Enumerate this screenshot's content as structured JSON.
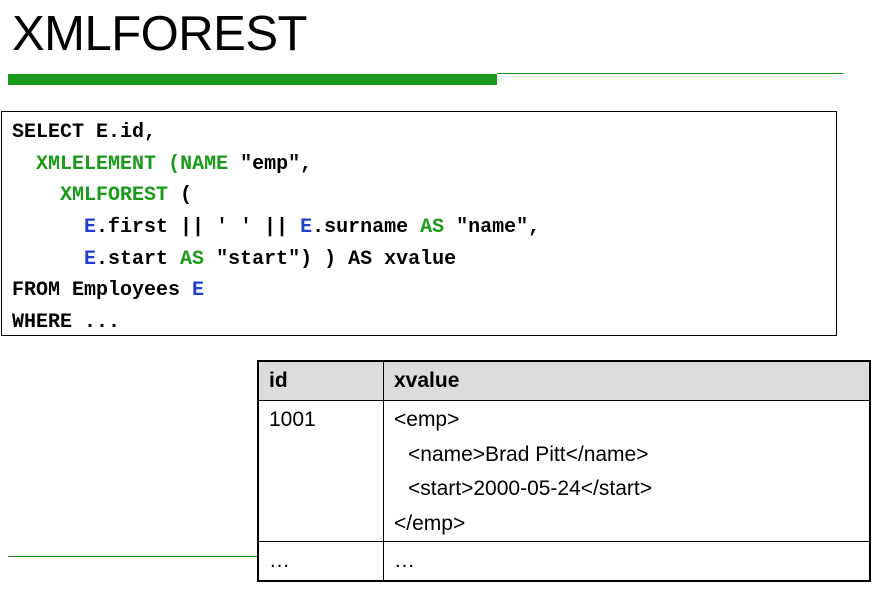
{
  "title": "XMLFOREST",
  "code": {
    "line1": "SELECT E.id,",
    "line2_indent": "  ",
    "line2_xmlelement": "XMLELEMENT",
    "line2_name": "(NAME",
    "line2_rest": " \"emp\",",
    "line3_indent": "    ",
    "line3_xmlforest": "XMLFOREST",
    "line3_rest": " (",
    "line4_indent": "      ",
    "line4_e1": "E",
    "line4_mid": ".first || ' ' || ",
    "line4_e2": "E",
    "line4_mid2": ".surname ",
    "line4_as": "AS",
    "line4_rest": " \"name\",",
    "line5_indent": "      ",
    "line5_e": "E",
    "line5_mid": ".start ",
    "line5_as": "AS",
    "line5_rest": " \"start\") ) AS xvalue",
    "line6_pre": "FROM Employees ",
    "line6_e": "E",
    "line7": "WHERE ..."
  },
  "table": {
    "headers": [
      "id",
      "xvalue"
    ],
    "rows": [
      {
        "id": "1001",
        "xvalue": [
          "<emp>",
          "<name>Brad Pitt</name>",
          "<start>2000-05-24</start>",
          "</emp>"
        ]
      },
      {
        "id": "…",
        "xvalue": [
          "…"
        ]
      }
    ]
  },
  "colors": {
    "accent_green": "#1a9a1a",
    "keyword_blue": "#1e3fc8",
    "header_gray": "#dcdcdc"
  }
}
